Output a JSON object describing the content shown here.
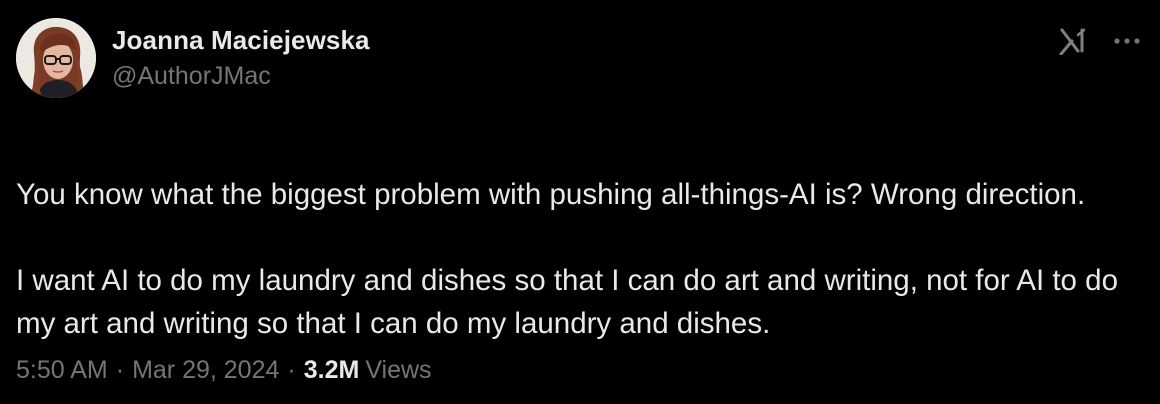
{
  "author": {
    "display_name": "Joanna Maciejewska",
    "handle": "@AuthorJMac",
    "avatar_icon": "profile-photo"
  },
  "header_actions": {
    "grok_icon": "grok-icon",
    "more_icon": "more-icon"
  },
  "tweet": {
    "text_lines": [
      "You know what the biggest problem with pushing all-things-AI is? Wrong direction.",
      "I want AI to do my laundry and dishes so that I can do art and writing, not for AI to do my art and writing so that I can do my laundry and dishes."
    ]
  },
  "meta": {
    "time": "5:50 AM",
    "separator": "·",
    "date": "Mar 29, 2024",
    "views_count": "3.2M",
    "views_label": "Views"
  },
  "colors": {
    "background": "#000000",
    "primary_text": "#e7e9ea",
    "secondary_text": "#71767b"
  }
}
